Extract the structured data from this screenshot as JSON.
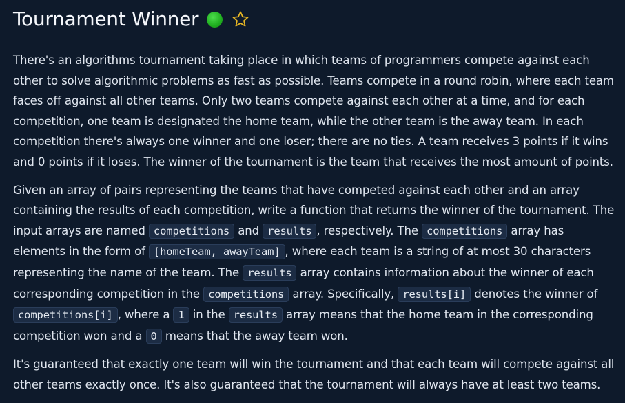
{
  "header": {
    "title": "Tournament Winner",
    "difficulty_color": "#22bb22",
    "difficulty_icon": "green-dot-icon",
    "favorite_icon": "star-outline-icon",
    "accent_color": "#e9b824"
  },
  "p1": {
    "text": "There's an algorithms tournament taking place in which teams of programmers compete against each other to solve algorithmic problems as fast as possible. Teams compete in a round robin, where each team faces off against all other teams. Only two teams compete against each other at a time, and for each competition, one team is designated the home team, while the other team is the away team. In each competition there's always one winner and one loser; there are no ties. A team receives 3 points if it wins and 0 points if it loses. The winner of the tournament is the team that receives the most amount of points."
  },
  "p2": {
    "t1": "Given an array of pairs representing the teams that have competed against each other and an array containing the results of each competition, write a function that returns the winner of the tournament. The input arrays are named ",
    "c1": "competitions",
    "t2": " and ",
    "c2": "results",
    "t3": ", respectively. The ",
    "c3": "competitions",
    "t4": " array has elements in the form of ",
    "c4": "[homeTeam, awayTeam]",
    "t5": ", where each team is a string of at most 30 characters representing the name of the team. The ",
    "c5": "results",
    "t6": " array contains information about the winner of each corresponding competition in the ",
    "c6": "competitions",
    "t7": " array. Specifically, ",
    "c7": "results[i]",
    "t8": " denotes the winner of ",
    "c8": "competitions[i]",
    "t9": ", where a ",
    "c9": "1",
    "t10": " in the ",
    "c10": "results",
    "t11": " array means that the home team in the corresponding competition won and a ",
    "c11": "0",
    "t12": " means that the away team won."
  },
  "p3": {
    "text": "It's guaranteed that exactly one team will win the tournament and that each team will compete against all other teams exactly once. It's also guaranteed that the tournament will always have at least two teams."
  }
}
